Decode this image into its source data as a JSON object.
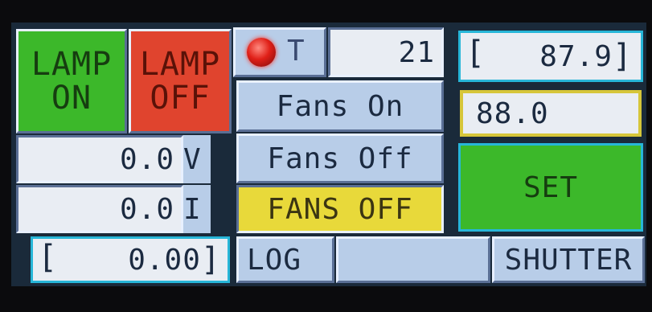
{
  "lamp": {
    "on_line1": "LAMP",
    "on_line2": "ON",
    "off_line1": "LAMP",
    "off_line2": "OFF"
  },
  "indicator": {
    "t_label": "T",
    "value": "21",
    "led_color": "#e02018"
  },
  "fans": {
    "on_label": "Fans On",
    "off_label": "Fans Off",
    "status": "FANS OFF"
  },
  "readings": {
    "voltage_value": "0.0",
    "voltage_unit": "V",
    "current_value": "0.0",
    "current_unit": "I",
    "total_value": "0.00"
  },
  "setpoint": {
    "current_value": "87.9",
    "target_value": "88.0",
    "set_label": "SET"
  },
  "bottom": {
    "log_label": "LOG",
    "shutter_label": "SHUTTER"
  },
  "colors": {
    "green": "#3cb82a",
    "red": "#e0442e",
    "yellow": "#e8d93a",
    "light_blue": "#b8cde8",
    "white": "#e9edf3"
  }
}
